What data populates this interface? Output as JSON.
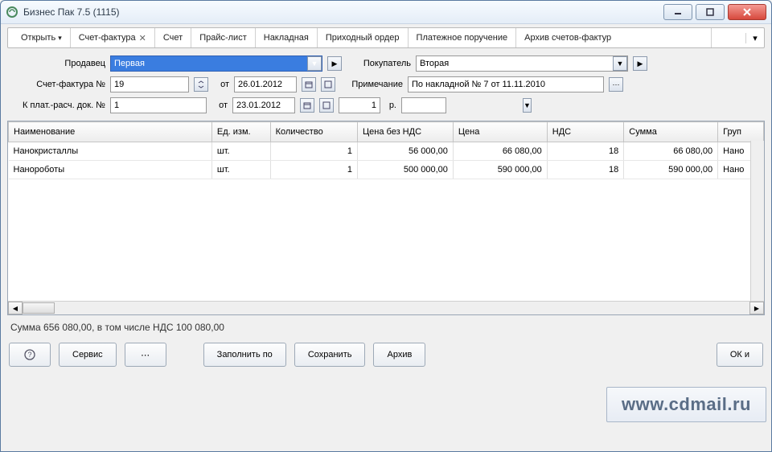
{
  "window": {
    "title": "Бизнес Пак 7.5 (1115)"
  },
  "tabs": {
    "open": "Открыть",
    "active": "Счет-фактура",
    "t3": "Счет",
    "t4": "Прайс-лист",
    "t5": "Накладная",
    "t6": "Приходный ордер",
    "t7": "Платежное поручение",
    "t8": "Архив счетов-фактур"
  },
  "form": {
    "seller_lbl": "Продавец",
    "seller_val": "Первая",
    "buyer_lbl": "Покупатель",
    "buyer_val": "Вторая",
    "invoice_no_lbl": "Счет-фактура №",
    "invoice_no_val": "19",
    "from1": "от",
    "date1": "26.01.2012",
    "note_lbl": "Примечание",
    "note_val": "По накладной № 7 от 11.11.2010",
    "paydoc_lbl": "К плат.-расч. док. №",
    "paydoc_val": "1",
    "from2": "от",
    "date2": "23.01.2012",
    "qty_small": "1",
    "currency": "р."
  },
  "grid": {
    "headers": {
      "name": "Наименование",
      "unit": "Ед. изм.",
      "qty": "Количество",
      "price_no_vat": "Цена без НДС",
      "price": "Цена",
      "vat": "НДС",
      "sum": "Сумма",
      "group": "Груп"
    },
    "rows": [
      {
        "name": "Нанокристаллы",
        "unit": "шт.",
        "qty": "1",
        "price_no_vat": "56 000,00",
        "price": "66 080,00",
        "vat": "18",
        "sum": "66 080,00",
        "group": "Нано"
      },
      {
        "name": "Нанороботы",
        "unit": "шт.",
        "qty": "1",
        "price_no_vat": "500 000,00",
        "price": "590 000,00",
        "vat": "18",
        "sum": "590 000,00",
        "group": "Нано"
      }
    ]
  },
  "status": "Сумма 656 080,00, в том числе НДС 100 080,00",
  "buttons": {
    "service": "Сервис",
    "fill": "Заполнить по",
    "save": "Сохранить",
    "archive": "Архив",
    "ok": "ОК и"
  },
  "watermark": "www.cdmail.ru"
}
